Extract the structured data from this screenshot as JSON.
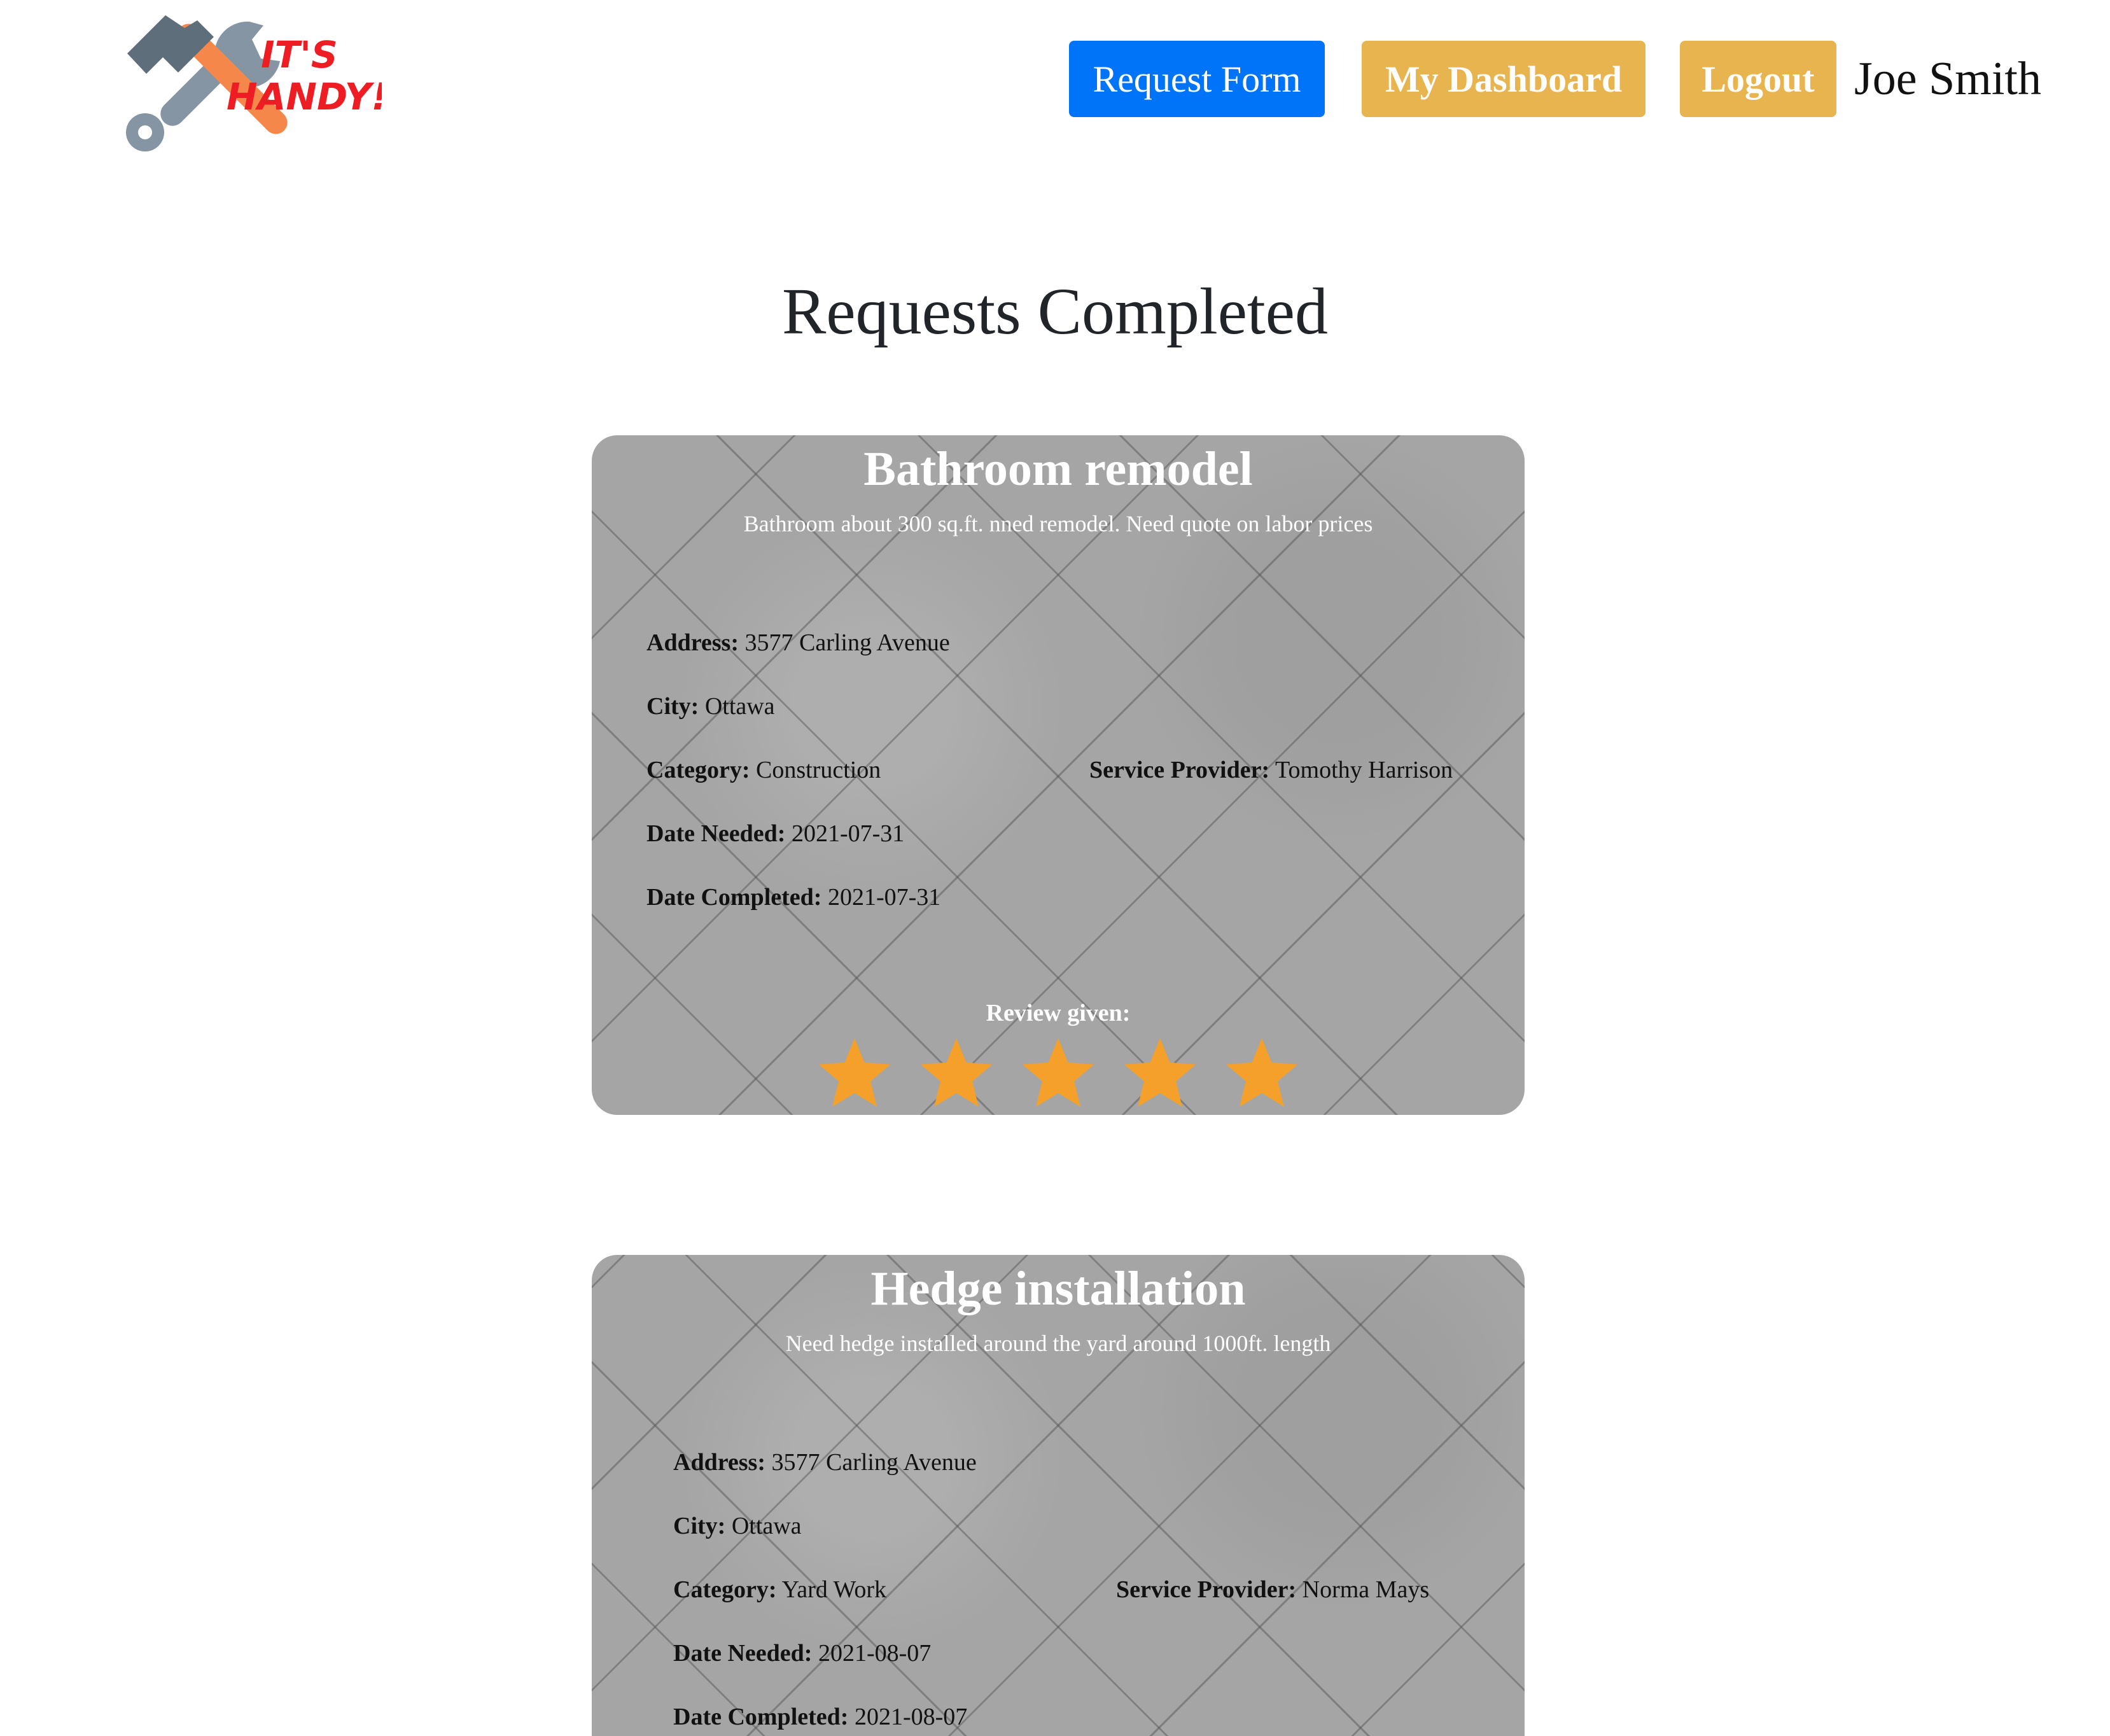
{
  "header": {
    "logo_text_line1": "IT'S",
    "logo_text_line2": "HANDY!",
    "request_form_label": "Request Form",
    "dashboard_label": "My Dashboard",
    "logout_label": "Logout",
    "user_name": "Joe Smith"
  },
  "colors": {
    "primary_button": "#0074f8",
    "secondary_button": "#e8b44f",
    "star": "#f5a02a",
    "logo_text": "#ee1d24"
  },
  "page_title": "Requests Completed",
  "labels": {
    "address": "Address:",
    "city": "City:",
    "category": "Category:",
    "service_provider": "Service Provider:",
    "date_needed": "Date Needed:",
    "date_completed": "Date Completed:",
    "review_given": "Review given:"
  },
  "requests": [
    {
      "title": "Bathroom remodel",
      "description": "Bathroom about 300 sq.ft. nned remodel. Need quote on labor prices",
      "address": "3577 Carling Avenue",
      "city": "Ottawa",
      "category": "Construction",
      "service_provider": "Tomothy Harrison",
      "date_needed": "2021-07-31",
      "date_completed": "2021-07-31",
      "rating": 5,
      "rating_max": 5
    },
    {
      "title": "Hedge installation",
      "description": "Need hedge installed around the yard around 1000ft. length",
      "address": "3577 Carling Avenue",
      "city": "Ottawa",
      "category": "Yard Work",
      "service_provider": "Norma Mays",
      "date_needed": "2021-08-07",
      "date_completed": "2021-08-07"
    }
  ]
}
